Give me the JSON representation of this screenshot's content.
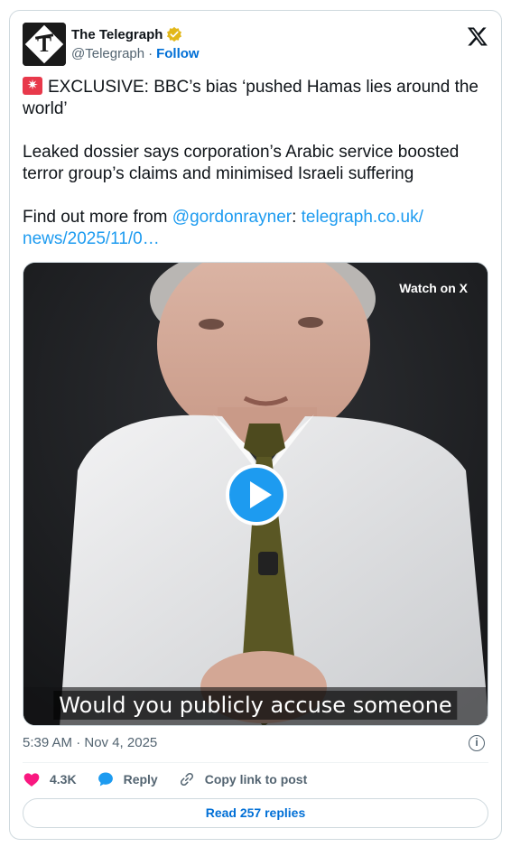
{
  "author": {
    "name": "The Telegraph",
    "handle": "@Telegraph",
    "separator": "·",
    "follow_label": "Follow"
  },
  "tweet": {
    "headline": "EXCLUSIVE: BBC’s bias ‘pushed Hamas lies around the world’",
    "body": "Leaked dossier says corporation’s Arabic service boosted terror group’s claims and minimised Israeli suffering",
    "find_out_prefix": "Find out more from ",
    "mention": "@gordonrayner",
    "colon": ": ",
    "url": "telegraph.co.uk/ news/2025/11/0…"
  },
  "media": {
    "watch_label": "Watch on X",
    "caption": "Would you publicly accuse someone"
  },
  "meta": {
    "timestamp": "5:39 AM · Nov 4, 2025",
    "info_glyph": "i"
  },
  "actions": {
    "likes": "4.3K",
    "reply_label": "Reply",
    "copy_label": "Copy link to post"
  },
  "footer": {
    "read_replies": "Read 257 replies"
  },
  "colors": {
    "accent": "#1d9bf0",
    "link": "#006fd6",
    "like": "#f91880",
    "verified": "#e2b719"
  }
}
